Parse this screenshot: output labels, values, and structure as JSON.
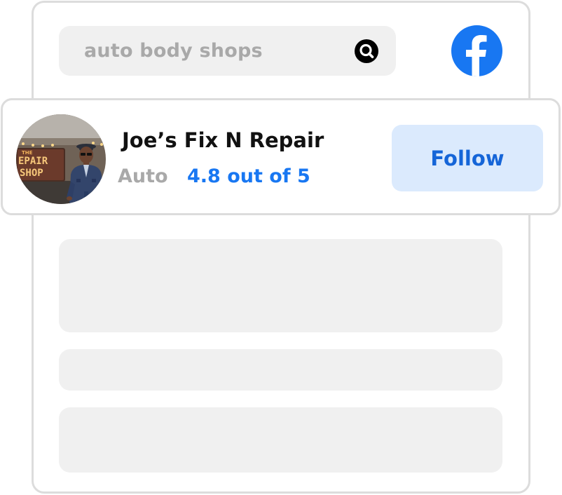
{
  "search": {
    "query": "auto body shops",
    "icon": "search-icon"
  },
  "brand": {
    "icon": "facebook-logo-icon",
    "color": "#1877F2"
  },
  "profile": {
    "name": "Joe’s Fix N Repair",
    "category": "Auto",
    "rating": "4.8 out of 5",
    "avatar_sign_text": "REPAIR SHOP",
    "follow_label": "Follow"
  },
  "colors": {
    "accent": "#1877F2",
    "follow_bg": "#DBEAFD",
    "muted_text": "#A9A9A9",
    "placeholder_bg": "#F0F0F0",
    "border": "#DCDCDC"
  }
}
